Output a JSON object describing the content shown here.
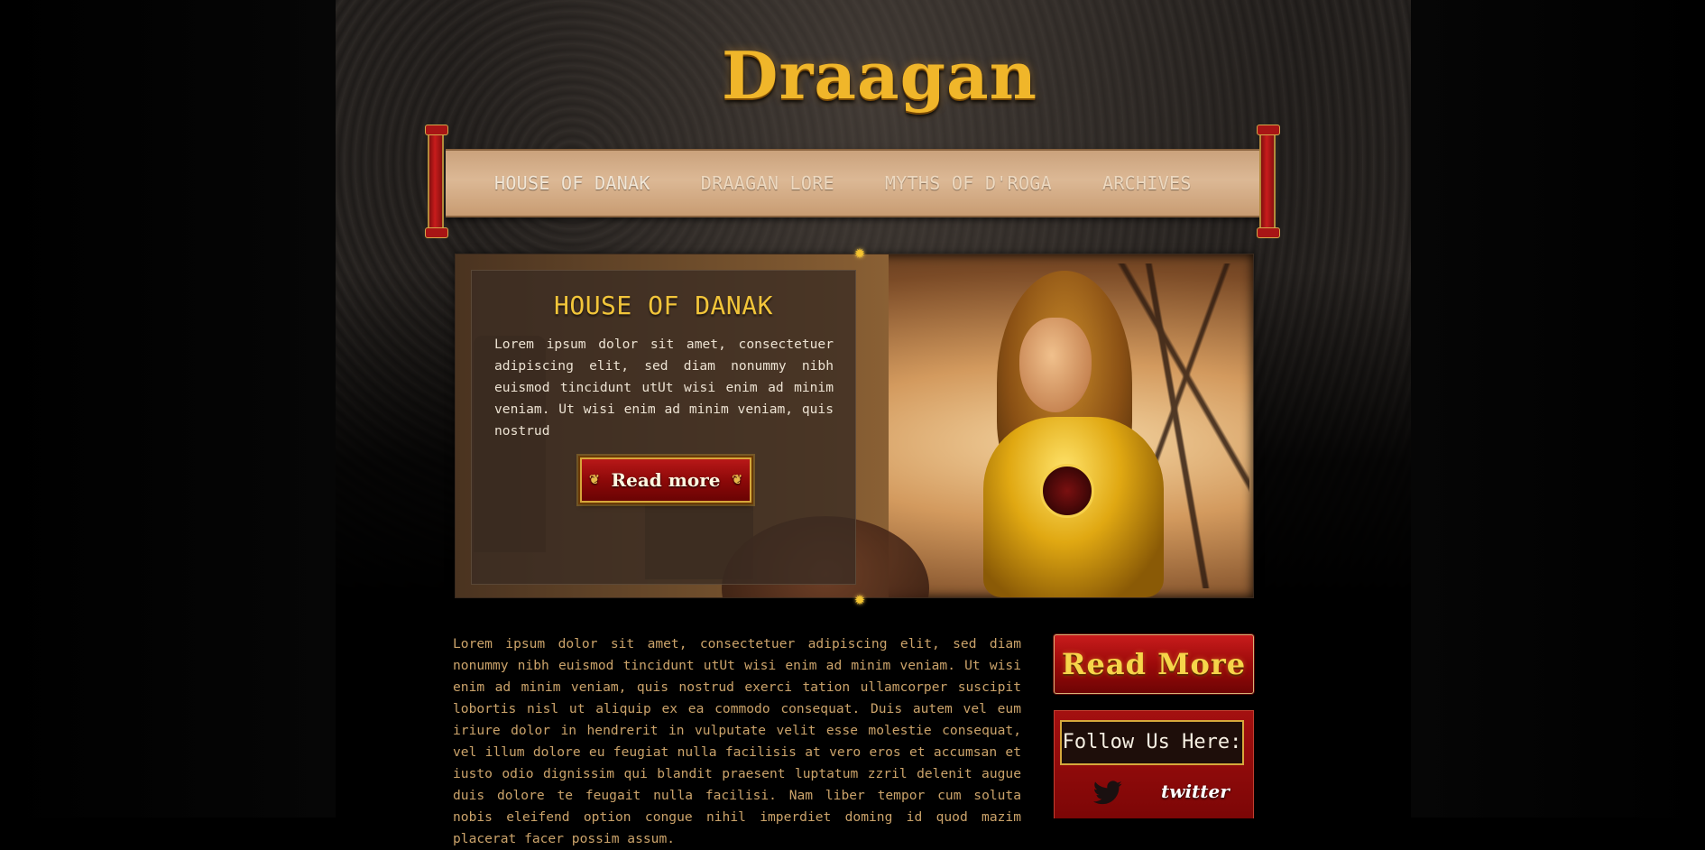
{
  "site": {
    "logo": "Draagan"
  },
  "nav": {
    "items": [
      {
        "label": "HOUSE OF DANAK"
      },
      {
        "label": "DRAAGAN LORE"
      },
      {
        "label": "MYTHS OF D'ROGA"
      },
      {
        "label": "ARCHIVES"
      }
    ]
  },
  "banner": {
    "title": "HOUSE OF DANAK",
    "text": "Lorem ipsum dolor sit amet, consectetuer adipiscing elit, sed diam nonummy nibh euismod tincidunt utUt wisi enim ad minim veniam. Ut wisi enim ad minim veniam, quis nostrud",
    "button_label": "Read more",
    "ornament_left": "❦",
    "ornament_right": "❦",
    "sun_glyph": "✹"
  },
  "main": {
    "text": "Lorem ipsum dolor sit amet, consectetuer adipiscing elit, sed diam nonummy nibh euismod tincidunt utUt wisi enim ad minim veniam. Ut wisi enim ad minim veniam, quis nostrud exerci tation ullamcorper suscipit lobortis nisl ut aliquip ex ea commodo consequat. Duis autem vel eum iriure dolor in hendrerit in vulputate velit esse molestie consequat, vel illum dolore eu feugiat nulla facilisis at vero eros et accumsan et iusto odio dignissim qui blandit praesent luptatum zzril delenit augue duis dolore te feugait nulla facilisi. Nam liber tempor cum soluta nobis eleifend option congue nihil imperdiet doming id quod mazim placerat facer possim assum."
  },
  "sidebar": {
    "read_more_label": "Read More",
    "follow_title": "Follow Us Here:",
    "social": [
      {
        "label": "twitter",
        "icon": "twitter-bird-icon"
      }
    ]
  },
  "colors": {
    "accent_gold": "#f2c53a",
    "button_red": "#9c0a0a",
    "parchment": "#dcb895",
    "body_text": "#cba36a"
  }
}
